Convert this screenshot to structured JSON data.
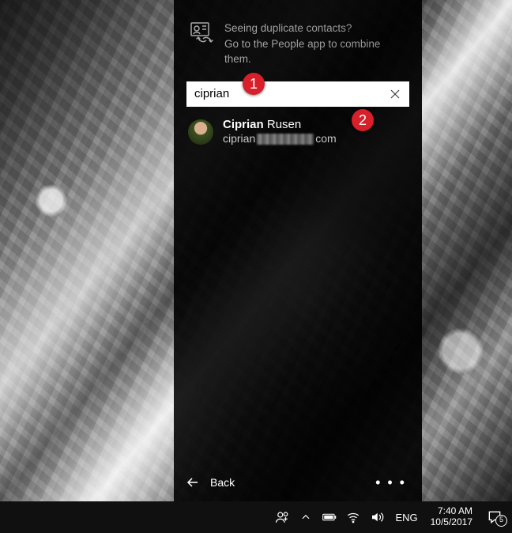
{
  "hint": {
    "line1": "Seeing duplicate contacts?",
    "line2": "Go to the People app to combine them."
  },
  "search": {
    "value": "ciprian",
    "placeholder": ""
  },
  "result": {
    "name_highlight": "Ciprian",
    "name_rest": " Rusen",
    "email_prefix": "ciprian",
    "email_suffix": "com"
  },
  "footer": {
    "back": "Back",
    "more": "• • •"
  },
  "markers": {
    "m1": "1",
    "m2": "2"
  },
  "taskbar": {
    "lang": "ENG",
    "time": "7:40 AM",
    "date": "10/5/2017",
    "notif_count": "5"
  }
}
